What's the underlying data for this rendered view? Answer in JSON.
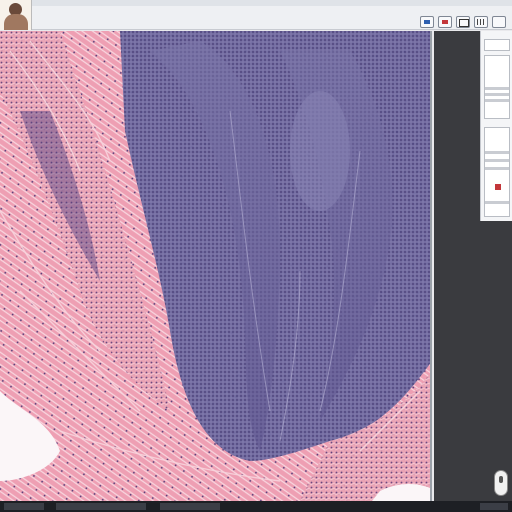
{
  "app": {
    "title": "",
    "status_text": ""
  },
  "toolbar": {
    "buttons": [
      "layers-icon",
      "annotate-icon",
      "zoom-icon",
      "grid-icon",
      "fullscreen-icon"
    ]
  },
  "viewer": {
    "content": "histology-slide",
    "stain_colors": {
      "eosin": "#e69aae",
      "hematoxylin": "#5f5790",
      "background": "#ffffff"
    }
  },
  "colors": {
    "panel_dark": "#3a3b3f",
    "accent_blue": "#2d5fb0",
    "accent_red": "#c3363a"
  }
}
